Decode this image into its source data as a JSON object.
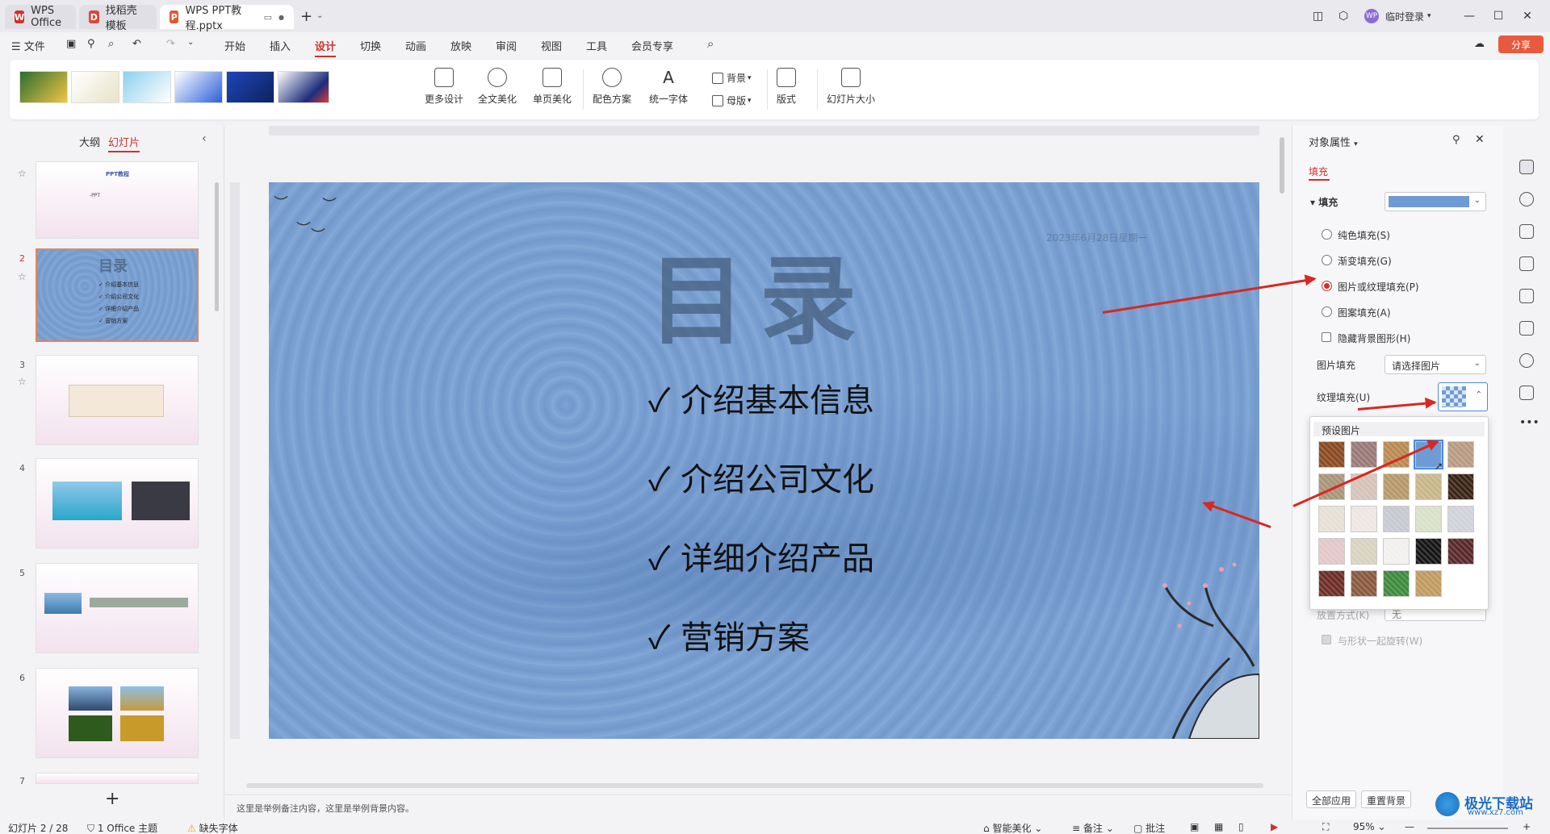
{
  "tabs": [
    {
      "label": "WPS Office",
      "active": false
    },
    {
      "label": "找稻壳模板",
      "active": false
    },
    {
      "label": "WPS PPT教程.pptx",
      "active": true
    }
  ],
  "titlebar": {
    "login": "临时登录"
  },
  "menu": {
    "file": "文件",
    "items": [
      "开始",
      "插入",
      "设计",
      "切换",
      "动画",
      "放映",
      "审阅",
      "视图",
      "工具",
      "会员专享"
    ],
    "active": "设计",
    "share": "分享"
  },
  "ribbon": {
    "more_design": "更多设计",
    "beautify_all": "全文美化",
    "beautify_page": "单页美化",
    "color_scheme": "配色方案",
    "unify_font": "统一字体",
    "background": "背景",
    "master": "母版",
    "layout": "版式",
    "slide_size": "幻灯片大小"
  },
  "left_panel": {
    "tab_outline": "大纲",
    "tab_slides": "幻灯片",
    "slides": [
      {
        "num": "",
        "title": "PPT教程",
        "subtitle": "-PPT"
      },
      {
        "num": "2",
        "title": "目录",
        "items": [
          "介绍基本信息",
          "介绍公司文化",
          "详细介绍产品",
          "营销方案"
        ]
      },
      {
        "num": "3"
      },
      {
        "num": "4"
      },
      {
        "num": "5"
      },
      {
        "num": "6"
      },
      {
        "num": "7"
      }
    ]
  },
  "slide": {
    "title": "目录",
    "date": "2023年6月28日星期一",
    "items": [
      "介绍基本信息",
      "介绍公司文化",
      "详细介绍产品",
      "营销方案"
    ],
    "checkmark": "✓"
  },
  "notes": "这里是举例备注内容，这里是举例背景内容。",
  "props": {
    "title": "对象属性",
    "tab_fill": "填充",
    "fill_label": "填充",
    "options": [
      "纯色填充(S)",
      "渐变填充(G)",
      "图片或纹理填充(P)",
      "图案填充(A)"
    ],
    "selected_option": "图片或纹理填充(P)",
    "hide_bg": "隐藏背景图形(H)",
    "picture_fill_label": "图片填充",
    "picture_fill_value": "请选择图片",
    "texture_fill_label": "纹理填充(U)",
    "preset_title": "预设图片",
    "partial_label": "放置方式(K)",
    "partial_value": "无",
    "rotate_with_shape": "与形状一起旋转(W)",
    "apply_all": "全部应用",
    "reset_bg": "重置背景",
    "accent": "#d0302b"
  },
  "textures": [
    "#8a4a22",
    "#9a7a78",
    "#b88a52",
    "#6f9bd4",
    "#b89a82",
    "#a89478",
    "#d5c2b8",
    "#b6986a",
    "#c8b68a",
    "#3a2418",
    "#e6e0d4",
    "#efe6e2",
    "#c6c8d2",
    "#d8e0c8",
    "#d0d2dc",
    "#e2c6c8",
    "#d8d2c0",
    "#f2f0ee",
    "#161616",
    "#5a2a2a",
    "#6e2e26",
    "#8a5a3e",
    "#3e8a3e",
    "#c09a60"
  ],
  "statusbar": {
    "slide_info": "幻灯片 2 / 28",
    "theme": "1 Office 主题",
    "missing_font": "缺失字体",
    "smart_beautify": "智能美化",
    "notes": "备注",
    "comments": "批注",
    "zoom": "95%"
  },
  "watermark": "极光下载站",
  "watermark_url": "www.xz7.com"
}
